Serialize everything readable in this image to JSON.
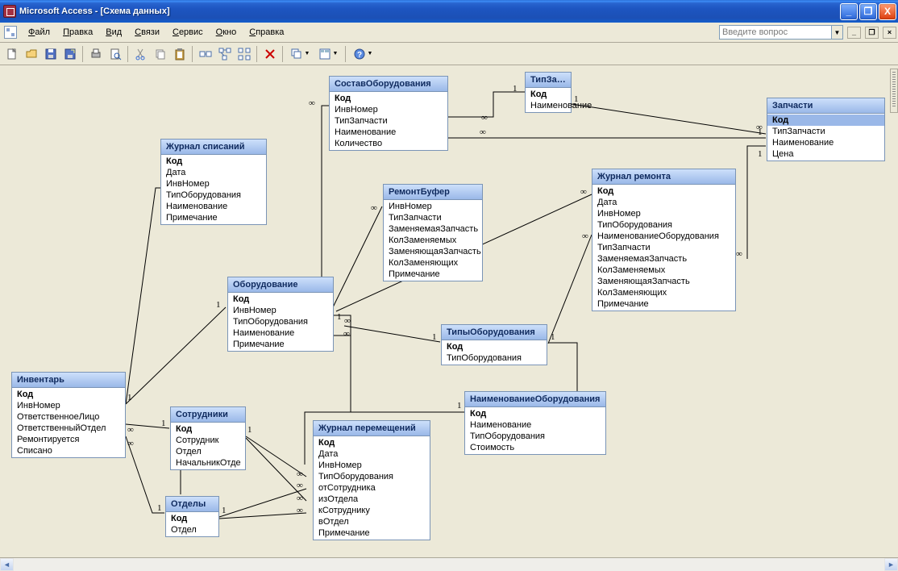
{
  "window": {
    "title": "Microsoft Access - [Схема данных]",
    "minimize": "_",
    "restore": "❐",
    "close": "X"
  },
  "menu": {
    "items": [
      {
        "hot": "Ф",
        "rest": "айл"
      },
      {
        "hot": "П",
        "rest": "равка"
      },
      {
        "hot": "В",
        "rest": "ид"
      },
      {
        "hot": "С",
        "rest": "вязи"
      },
      {
        "hot": "С",
        "rest": "ервис"
      },
      {
        "hot": "О",
        "rest": "кно"
      },
      {
        "hot": "С",
        "rest": "правка"
      }
    ],
    "ask_placeholder": "Введите вопрос",
    "mdi": {
      "min": "_",
      "restore": "❐",
      "close": "×"
    }
  },
  "toolbar_icons": [
    "new",
    "open",
    "save",
    "saveas",
    "|",
    "print",
    "preview",
    "|",
    "cut",
    "copy",
    "paste",
    "|",
    "relationships",
    "show-direct",
    "show-all",
    "|",
    "delete",
    "|",
    "window-cascade",
    "window-tile",
    "|",
    "help-drop"
  ],
  "tables": {
    "sostav": {
      "title": "СоставОборудования",
      "fields": [
        "Код",
        "ИнвНомер",
        "ТипЗапчасти",
        "Наименование",
        "Количество"
      ],
      "pk": [
        0
      ]
    },
    "tipzap": {
      "title": "ТипЗапча...",
      "fields": [
        "Код",
        "Наименование"
      ],
      "pk": [
        0
      ]
    },
    "zapchasti": {
      "title": "Запчасти",
      "fields": [
        "Код",
        "ТипЗапчасти",
        "Наименование",
        "Цена"
      ],
      "pk": [
        0
      ],
      "sel": [
        0
      ]
    },
    "journal_spis": {
      "title": "Журнал списаний",
      "fields": [
        "Код",
        "Дата",
        "ИнвНомер",
        "ТипОборудования",
        "Наименование",
        "Примечание"
      ],
      "pk": [
        0
      ]
    },
    "remontbuf": {
      "title": "РемонтБуфер",
      "fields": [
        "ИнвНомер",
        "ТипЗапчасти",
        "ЗаменяемаяЗапчасть",
        "КолЗаменяемых",
        "ЗаменяющаяЗапчасть",
        "КолЗаменяющих",
        "Примечание"
      ],
      "pk": []
    },
    "journal_rem": {
      "title": "Журнал ремонта",
      "fields": [
        "Код",
        "Дата",
        "ИнвНомер",
        "ТипОборудования",
        "НаименованиеОборудования",
        "ТипЗапчасти",
        "ЗаменяемаяЗапчасть",
        "КолЗаменяемых",
        "ЗаменяющаяЗапчасть",
        "КолЗаменяющих",
        "Примечание"
      ],
      "pk": [
        0
      ]
    },
    "oborud": {
      "title": "Оборудование",
      "fields": [
        "Код",
        "ИнвНомер",
        "ТипОборудования",
        "Наименование",
        "Примечание"
      ],
      "pk": [
        0
      ]
    },
    "tipob": {
      "title": "ТипыОборудования",
      "fields": [
        "Код",
        "ТипОборудования"
      ],
      "pk": [
        0
      ]
    },
    "invent": {
      "title": "Инвентарь",
      "fields": [
        "Код",
        "ИнвНомер",
        "ОтветственноеЛицо",
        "ОтветственныйОтдел",
        "Ремонтируется",
        "Списано"
      ],
      "pk": [
        0
      ]
    },
    "sotrud": {
      "title": "Сотрудники",
      "fields": [
        "Код",
        "Сотрудник",
        "Отдел",
        "НачальникОтде"
      ],
      "pk": [
        0
      ]
    },
    "naimob": {
      "title": "НаименованиеОборудования",
      "fields": [
        "Код",
        "Наименование",
        "ТипОборудования",
        "Стоимость"
      ],
      "pk": [
        0
      ]
    },
    "journal_per": {
      "title": "Журнал перемещений",
      "fields": [
        "Код",
        "Дата",
        "ИнвНомер",
        "ТипОборудования",
        "отСотрудника",
        "изОтдела",
        "кСотруднику",
        "вОтдел",
        "Примечание"
      ],
      "pk": [
        0
      ]
    },
    "otdely": {
      "title": "Отделы",
      "fields": [
        "Код",
        "Отдел"
      ],
      "pk": [
        0
      ]
    }
  },
  "rel_labels": {
    "one": "1",
    "many": "∞"
  }
}
